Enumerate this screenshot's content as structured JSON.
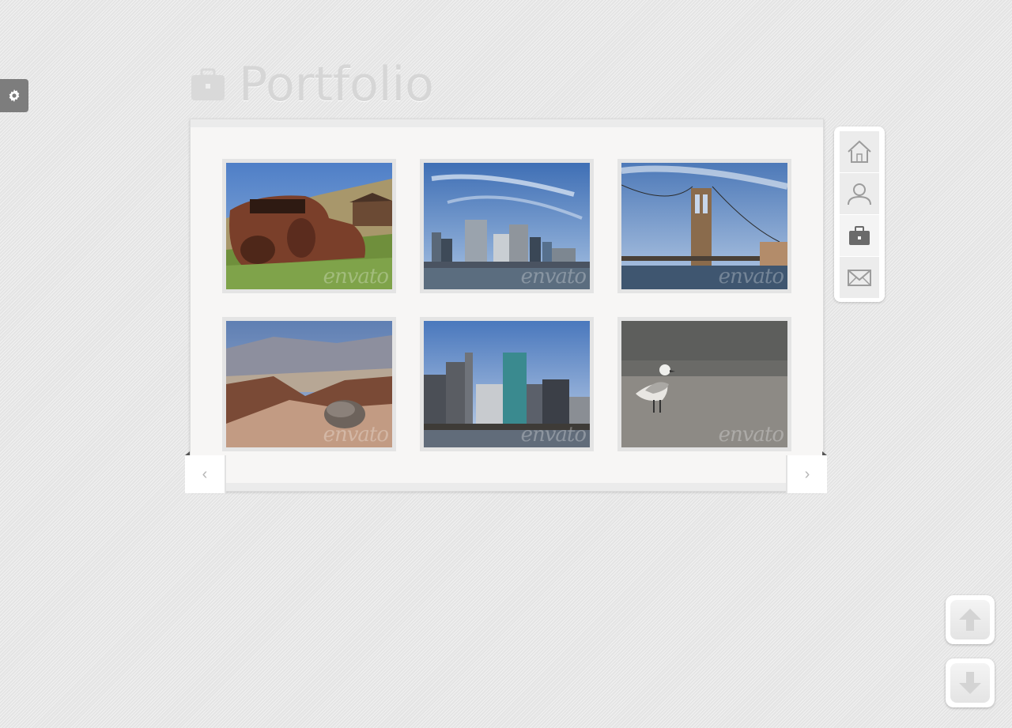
{
  "header": {
    "title": "Portfolio",
    "icon": "briefcase-icon"
  },
  "settings": {
    "icon": "gear-icon"
  },
  "gallery": {
    "watermark": "envato",
    "items": [
      {
        "subject": "rusty-car"
      },
      {
        "subject": "city-skyline"
      },
      {
        "subject": "bridge"
      },
      {
        "subject": "desert"
      },
      {
        "subject": "city-towers"
      },
      {
        "subject": "seagull"
      }
    ]
  },
  "pager": {
    "prev_label": "‹",
    "next_label": "›"
  },
  "side_nav": {
    "items": [
      {
        "icon": "home-icon",
        "active": false
      },
      {
        "icon": "user-icon",
        "active": false
      },
      {
        "icon": "briefcase-icon",
        "active": true
      },
      {
        "icon": "mail-icon",
        "active": false
      }
    ]
  },
  "scroll": {
    "up_icon": "arrow-up-icon",
    "down_icon": "arrow-down-icon"
  },
  "colors": {
    "background": "#e9e9e9",
    "panel": "#f7f6f5",
    "title": "#d6d6d6",
    "settings_tab": "#7d7d7d"
  }
}
